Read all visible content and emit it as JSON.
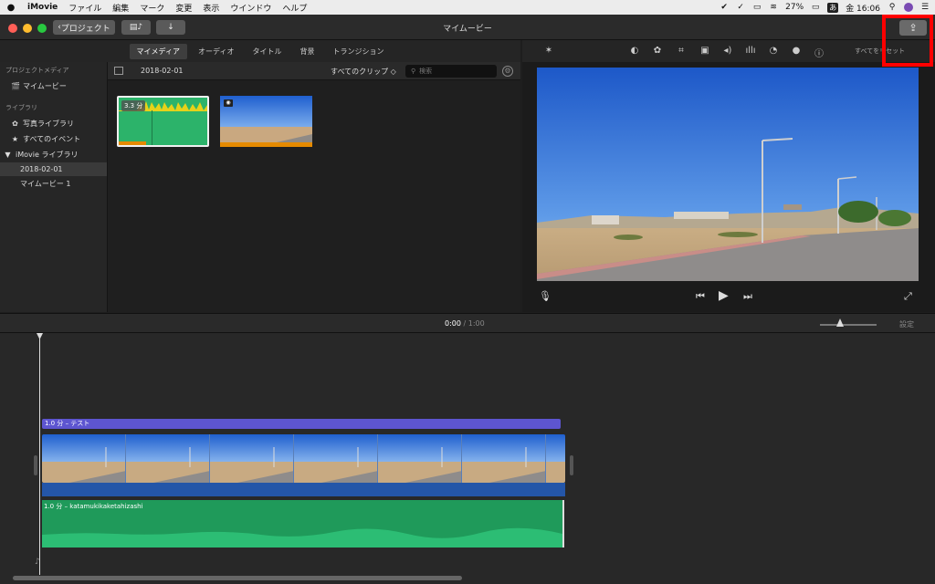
{
  "menubar": {
    "app_name": "iMovie",
    "items": [
      "ファイル",
      "編集",
      "マーク",
      "変更",
      "表示",
      "ウインドウ",
      "ヘルプ"
    ],
    "battery": "27%",
    "ime": "あ",
    "clock": "金 16:06"
  },
  "titlebar": {
    "back_label": "プロジェクト",
    "title": "マイムービー"
  },
  "tabs": [
    "マイメディア",
    "オーディオ",
    "タイトル",
    "背景",
    "トランジション"
  ],
  "sidebar": {
    "section_project": "プロジェクトメディア",
    "project_item": "マイムービー",
    "section_library": "ライブラリ",
    "photos": "写真ライブラリ",
    "all_events": "すべてのイベント",
    "imovie_library": "iMovie ライブラリ",
    "event_date": "2018-02-01",
    "movie1": "マイムービー 1"
  },
  "browser": {
    "date": "2018-02-01",
    "filter": "すべてのクリップ ◇",
    "search_placeholder": "検索",
    "clip1_duration": "3.3 分"
  },
  "viewer_tools": {
    "label": "すべてをリセット"
  },
  "timeline": {
    "current_time": "0:00",
    "separator": " / ",
    "total_time": "1:00",
    "settings": "設定",
    "title_clip": "1.0 分 – テスト",
    "audio_clip": "1.0 分 – katamukikaketahizashi"
  },
  "colors": {
    "accent_highlight": "#ff0000",
    "title_clip": "#5d55d0",
    "audio_clip": "#1f9a5a",
    "video_clip_base": "#2456a8"
  }
}
